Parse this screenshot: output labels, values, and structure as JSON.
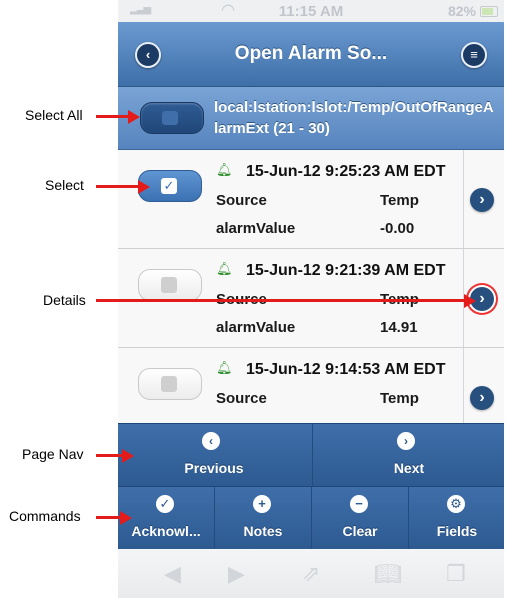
{
  "status": {
    "time": "11:15 AM",
    "battery": "82%"
  },
  "header": {
    "title": "Open Alarm So..."
  },
  "select_all": {
    "path": "local:lstation:lslot:/Temp/OutOfRangeAlarmExt (21 - 30)"
  },
  "rows": [
    {
      "timestamp": "15-Jun-12 9:25:23 AM EDT",
      "label1": "Source",
      "value1": "Temp",
      "label2": "alarmValue",
      "value2": "-0.00",
      "checked": "true"
    },
    {
      "timestamp": "15-Jun-12 9:21:39 AM EDT",
      "label1": "Source",
      "value1": "Temp",
      "label2": "alarmValue",
      "value2": "14.91",
      "checked": "false"
    },
    {
      "timestamp": "15-Jun-12 9:14:53 AM EDT",
      "label1": "Source",
      "value1": "Temp",
      "checked": "false"
    }
  ],
  "page_nav": {
    "previous": "Previous",
    "next": "Next"
  },
  "commands": {
    "acknowledge": "Acknowl...",
    "notes": "Notes",
    "clear": "Clear",
    "fields": "Fields"
  },
  "annotations": {
    "select_all": "Select All",
    "select": "Select",
    "details": "Details",
    "page_nav": "Page Nav",
    "commands": "Commands"
  },
  "colors": {
    "header": "#4a7ab4",
    "annotation_arrow": "#e31b1b",
    "bell": "#2f8f2f"
  }
}
